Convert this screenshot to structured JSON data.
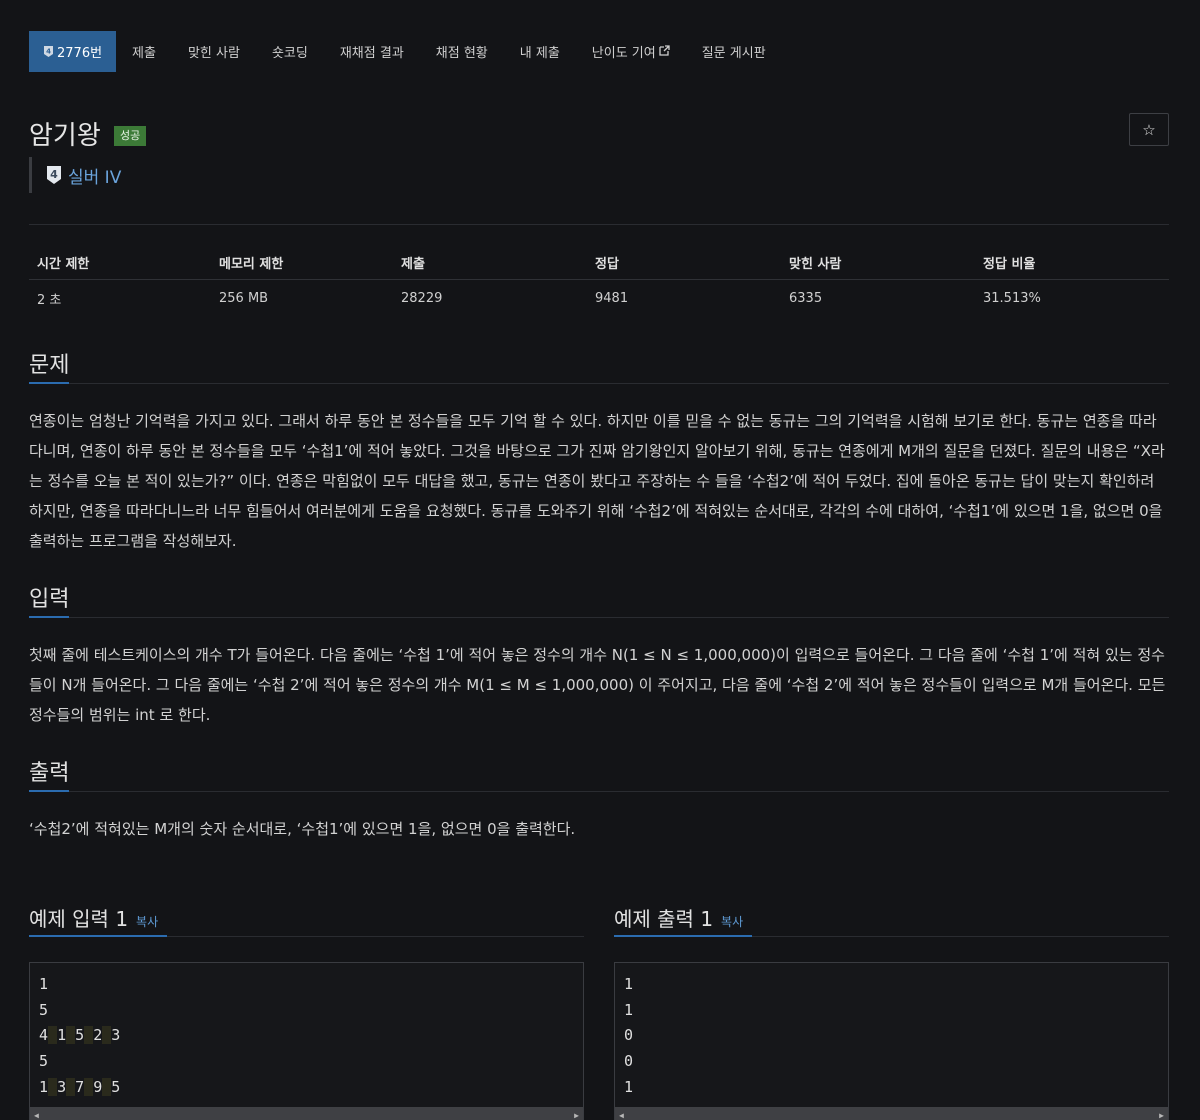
{
  "tabs": [
    {
      "label": "2776번",
      "active": true
    },
    {
      "label": "제출"
    },
    {
      "label": "맞힌 사람"
    },
    {
      "label": "숏코딩"
    },
    {
      "label": "재채점 결과"
    },
    {
      "label": "채점 현황"
    },
    {
      "label": "내 제출"
    },
    {
      "label": "난이도 기여"
    },
    {
      "label": "질문 게시판"
    }
  ],
  "problem": {
    "title": "암기왕",
    "status_badge": "성공",
    "tier_number": "4",
    "tier_label": "실버 IV",
    "star_icon": "☆"
  },
  "stats": {
    "headers": [
      "시간 제한",
      "메모리 제한",
      "제출",
      "정답",
      "맞힌 사람",
      "정답 비율"
    ],
    "values": [
      "2 초",
      "256 MB",
      "28229",
      "9481",
      "6335",
      "31.513%"
    ]
  },
  "sections": {
    "problem": {
      "heading": "문제",
      "text": "연종이는 엄청난 기억력을 가지고 있다. 그래서 하루 동안 본 정수들을 모두 기억 할 수 있다. 하지만 이를 믿을 수 없는 동규는 그의 기억력을 시험해 보기로 한다. 동규는 연종을 따라 다니며, 연종이 하루 동안 본 정수들을 모두 ‘수첩1’에 적어 놓았다. 그것을 바탕으로 그가 진짜 암기왕인지 알아보기 위해, 동규는 연종에게 M개의 질문을 던졌다. 질문의 내용은 “X라는 정수를 오늘 본 적이 있는가?” 이다. 연종은 막힘없이 모두 대답을 했고, 동규는 연종이 봤다고 주장하는 수 들을 ‘수첩2’에 적어 두었다. 집에 돌아온 동규는 답이 맞는지 확인하려 하지만, 연종을 따라다니느라 너무 힘들어서 여러분에게 도움을 요청했다. 동규를 도와주기 위해 ‘수첩2’에 적혀있는 순서대로, 각각의 수에 대하여, ‘수첩1’에 있으면 1을, 없으면 0을 출력하는 프로그램을 작성해보자."
    },
    "input": {
      "heading": "입력",
      "text": "첫째 줄에 테스트케이스의 개수 T가 들어온다. 다음 줄에는 ‘수첩 1’에 적어 놓은 정수의 개수 N(1 ≤ N ≤ 1,000,000)이 입력으로 들어온다. 그 다음 줄에  ‘수첩 1’에 적혀 있는 정수들이 N개 들어온다. 그 다음 줄에는 ‘수첩 2’에 적어 놓은 정수의 개수 M(1 ≤ M ≤ 1,000,000) 이 주어지고, 다음 줄에 ‘수첩 2’에 적어 놓은 정수들이 입력으로 M개 들어온다. 모든 정수들의 범위는 int 로 한다."
    },
    "output": {
      "heading": "출력",
      "text": "‘수첩2’에 적혀있는 M개의 숫자 순서대로, ‘수첩1’에 있으면 1을, 없으면 0을 출력한다."
    }
  },
  "examples": {
    "input": {
      "heading": "예제 입력 1",
      "copy_label": "복사",
      "lines": [
        [
          "1"
        ],
        [
          "5"
        ],
        [
          "4",
          "1",
          "5",
          "2",
          "3"
        ],
        [
          "5"
        ],
        [
          "1",
          "3",
          "7",
          "9",
          "5"
        ]
      ]
    },
    "output": {
      "heading": "예제 출력 1",
      "copy_label": "복사",
      "lines": [
        [
          "1"
        ],
        [
          "1"
        ],
        [
          "0"
        ],
        [
          "0"
        ],
        [
          "1"
        ]
      ]
    }
  }
}
